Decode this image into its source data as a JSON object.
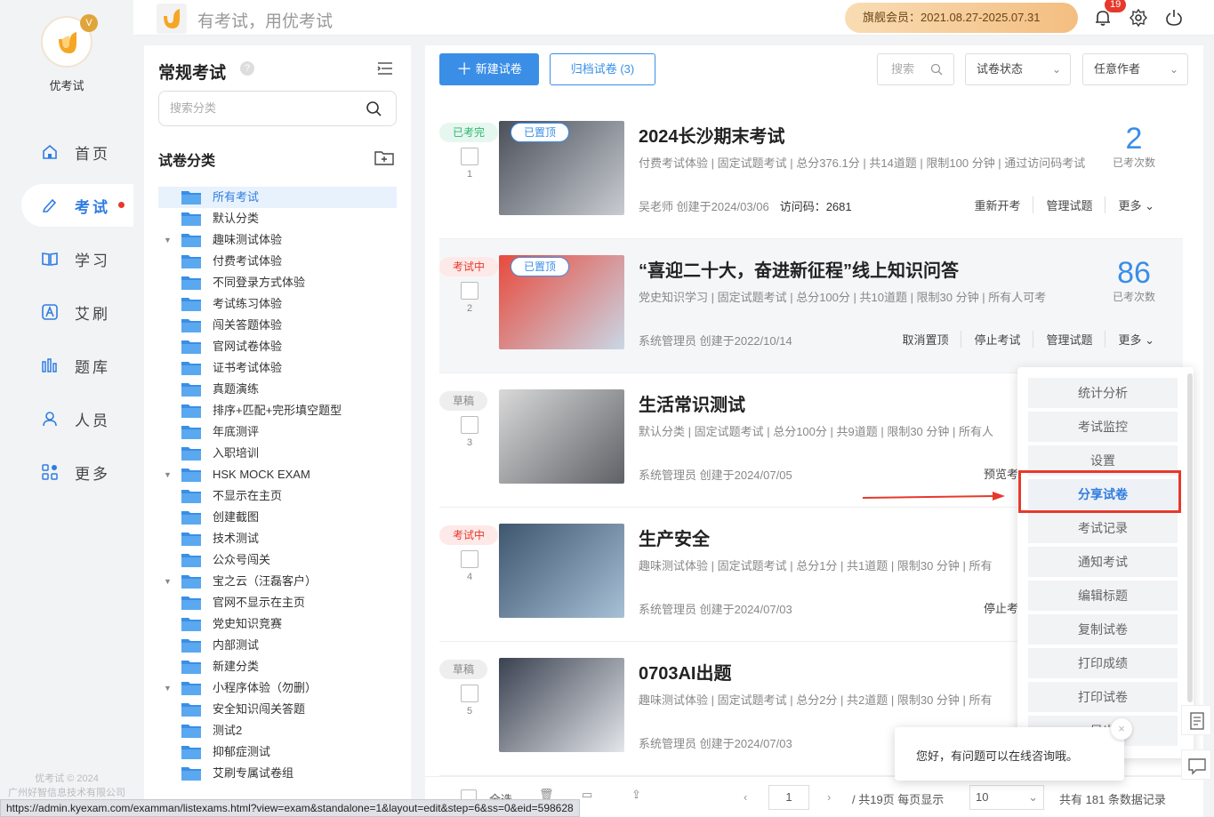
{
  "nav": {
    "logo_name": "优考试",
    "logo_badge": "V",
    "items": [
      {
        "label": "首页",
        "icon": "home-icon"
      },
      {
        "label": "考试",
        "icon": "exam-icon",
        "active": true
      },
      {
        "label": "学习",
        "icon": "book-icon"
      },
      {
        "label": "艾刷",
        "icon": "a-icon"
      },
      {
        "label": "题库",
        "icon": "bank-icon"
      },
      {
        "label": "人员",
        "icon": "user-icon"
      },
      {
        "label": "更多",
        "icon": "grid-icon"
      }
    ],
    "footer_line1": "优考试 © 2024",
    "footer_line2": "广州好智信息技术有限公司"
  },
  "topbar": {
    "slogan": "有考试，用优考试",
    "vip_text": "旗舰会员：2021.08.27-2025.07.31",
    "notif_count": "19"
  },
  "categories": {
    "title": "常规考试",
    "help": "?",
    "search_placeholder": "搜索分类",
    "section_title": "试卷分类",
    "items": [
      {
        "label": "所有考试",
        "selected": true,
        "caret": ""
      },
      {
        "label": "默认分类",
        "caret": ""
      },
      {
        "label": "趣味测试体验",
        "caret": "▼"
      },
      {
        "label": "付费考试体验",
        "caret": ""
      },
      {
        "label": "不同登录方式体验",
        "caret": ""
      },
      {
        "label": "考试练习体验",
        "caret": ""
      },
      {
        "label": "闯关答题体验",
        "caret": ""
      },
      {
        "label": "官网试卷体验",
        "caret": ""
      },
      {
        "label": "证书考试体验",
        "caret": ""
      },
      {
        "label": "真题演练",
        "caret": ""
      },
      {
        "label": "排序+匹配+完形填空题型",
        "caret": ""
      },
      {
        "label": "年底测评",
        "caret": ""
      },
      {
        "label": "入职培训",
        "caret": ""
      },
      {
        "label": "HSK MOCK EXAM",
        "caret": "▼"
      },
      {
        "label": "不显示在主页",
        "caret": ""
      },
      {
        "label": "创建截图",
        "caret": ""
      },
      {
        "label": "技术测试",
        "caret": ""
      },
      {
        "label": "公众号闯关",
        "caret": ""
      },
      {
        "label": "宝之云（汪磊客户）",
        "caret": "▼"
      },
      {
        "label": "官网不显示在主页",
        "caret": ""
      },
      {
        "label": "党史知识竞赛",
        "caret": ""
      },
      {
        "label": "内部测试",
        "caret": ""
      },
      {
        "label": "新建分类",
        "caret": ""
      },
      {
        "label": "小程序体验（勿删）",
        "caret": "▼"
      },
      {
        "label": "安全知识闯关答题",
        "caret": ""
      },
      {
        "label": "测试2",
        "caret": ""
      },
      {
        "label": "抑郁症测试",
        "caret": ""
      },
      {
        "label": "艾刷专属试卷组",
        "caret": ""
      }
    ]
  },
  "toolbar": {
    "new_label": "新建试卷",
    "archive_label": "归档试卷 (3)",
    "search_placeholder": "搜索",
    "status_select": "试卷状态",
    "author_select": "任意作者"
  },
  "exams": [
    {
      "index": "1",
      "title": "2024长沙期末考试",
      "tags": [
        {
          "text": "已考完",
          "kind": "done"
        },
        {
          "text": "已置顶",
          "kind": "top"
        }
      ],
      "meta": "付费考试体验 | 固定试题考试 | 总分376.1分 | 共14道题 | 限制100 分钟 | 通过访问码考试",
      "creator": "吴老师 创建于2024/03/06",
      "access": "访问码：2681",
      "count": "2",
      "count_label": "已考次数",
      "actions": [
        "重新开考",
        "管理试题",
        "更多 ⌄"
      ]
    },
    {
      "index": "2",
      "title": "“喜迎二十大，奋进新征程”线上知识问答",
      "tags": [
        {
          "text": "考试中",
          "kind": "ing"
        },
        {
          "text": "已置顶",
          "kind": "top"
        }
      ],
      "meta": "党史知识学习 | 固定试题考试 | 总分100分 | 共10道题 | 限制30 分钟 | 所有人可考",
      "creator": "系统管理员 创建于2022/10/14",
      "access": "",
      "count": "86",
      "count_label": "已考次数",
      "actions": [
        "取消置顶",
        "停止考试",
        "管理试题",
        "更多 ⌄"
      ]
    },
    {
      "index": "3",
      "title": "生活常识测试",
      "tags": [
        {
          "text": "草稿",
          "kind": "draft"
        }
      ],
      "meta": "默认分类 | 固定试题考试 | 总分100分 | 共9道题 | 限制30 分钟 | 所有人",
      "creator": "系统管理员 创建于2024/07/05",
      "access": "",
      "count": "",
      "count_label": "",
      "actions": [
        "预览考"
      ]
    },
    {
      "index": "4",
      "title": "生产安全",
      "tags": [
        {
          "text": "考试中",
          "kind": "ing"
        }
      ],
      "meta": "趣味测试体验 | 固定试题考试 | 总分1分 | 共1道题 | 限制30 分钟 | 所有",
      "creator": "系统管理员 创建于2024/07/03",
      "access": "",
      "count": "",
      "count_label": "",
      "actions": [
        "停止考"
      ]
    },
    {
      "index": "5",
      "title": "0703AI出题",
      "tags": [
        {
          "text": "草稿",
          "kind": "draft"
        }
      ],
      "meta": "趣味测试体验 | 固定试题考试 | 总分2分 | 共2道题 | 限制30 分钟 | 所有",
      "creator": "系统管理员 创建于2024/07/03",
      "access": "",
      "count": "",
      "count_label": "",
      "actions": []
    }
  ],
  "dropdown": {
    "items": [
      "统计分析",
      "考试监控",
      "设置",
      "分享试卷",
      "考试记录",
      "通知考试",
      "编辑标题",
      "复制试卷",
      "打印成绩",
      "打印试卷",
      "导出"
    ],
    "active_index": 3
  },
  "bottom": {
    "select_all": "全选",
    "page": "1",
    "page_info": "/ 共19页 每页显示",
    "page_size": "10",
    "total": "共有 181 条数据记录"
  },
  "chat": {
    "message": "您好，有问题可以在线咨询哦。",
    "close": "×"
  },
  "status_url": "https://admin.kyexam.com/examman/listexams.html?view=exam&standalone=1&layout=edit&step=6&ss=0&eid=598628",
  "colors": {
    "accent": "#3a8ee6",
    "danger": "#e6392b",
    "success": "#2eb873",
    "vip_gold": "#f3be80"
  }
}
